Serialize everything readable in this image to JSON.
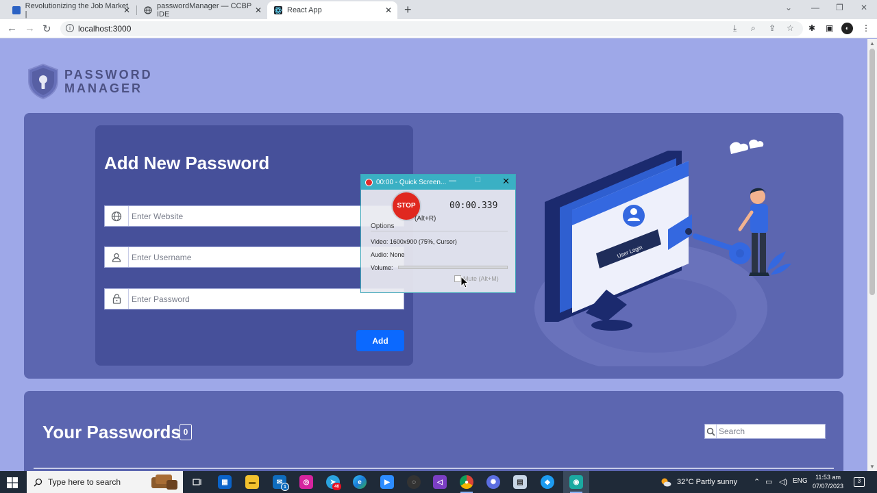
{
  "browser": {
    "tabs": [
      {
        "title": "Revolutionizing the Job Market |"
      },
      {
        "title": "passwordManager — CCBP IDE"
      },
      {
        "title": "React App"
      }
    ],
    "url": "localhost:3000"
  },
  "logo": {
    "line1": "PASSWORD",
    "line2": "MANAGER"
  },
  "form": {
    "title": "Add New Password",
    "website_placeholder": "Enter Website",
    "username_placeholder": "Enter Username",
    "password_placeholder": "Enter Password",
    "add_label": "Add"
  },
  "illustration": {
    "caption": "User Login"
  },
  "passwords": {
    "title": "Your Passwords",
    "count": "0",
    "search_placeholder": "Search"
  },
  "recorder": {
    "title": "00:00 - Quick Screen...",
    "stop_label": "STOP",
    "time": "00:00.339",
    "hotkey": "(Alt+R)",
    "options_label": "Options",
    "video": "Video: 1600x900 (75%, Cursor)",
    "audio": "Audio: None",
    "volume_label": "Volume:",
    "mute_label": "Mute (Alt+M)"
  },
  "taskbar": {
    "search_placeholder": "Type here to search",
    "weather": "32°C  Partly sunny",
    "lang": "ENG",
    "time": "11:53 am",
    "date": "07/07/2023",
    "notif_count": "3",
    "mail_badge": "1",
    "telegram_badge": "46"
  },
  "colors": {
    "page_bg": "#9ea8e8",
    "card_bg": "#5c66b0",
    "form_bg": "#46509a",
    "add_button": "#0b69ff",
    "recorder_title": "#3ab0c4",
    "stop": "#e0281f"
  }
}
